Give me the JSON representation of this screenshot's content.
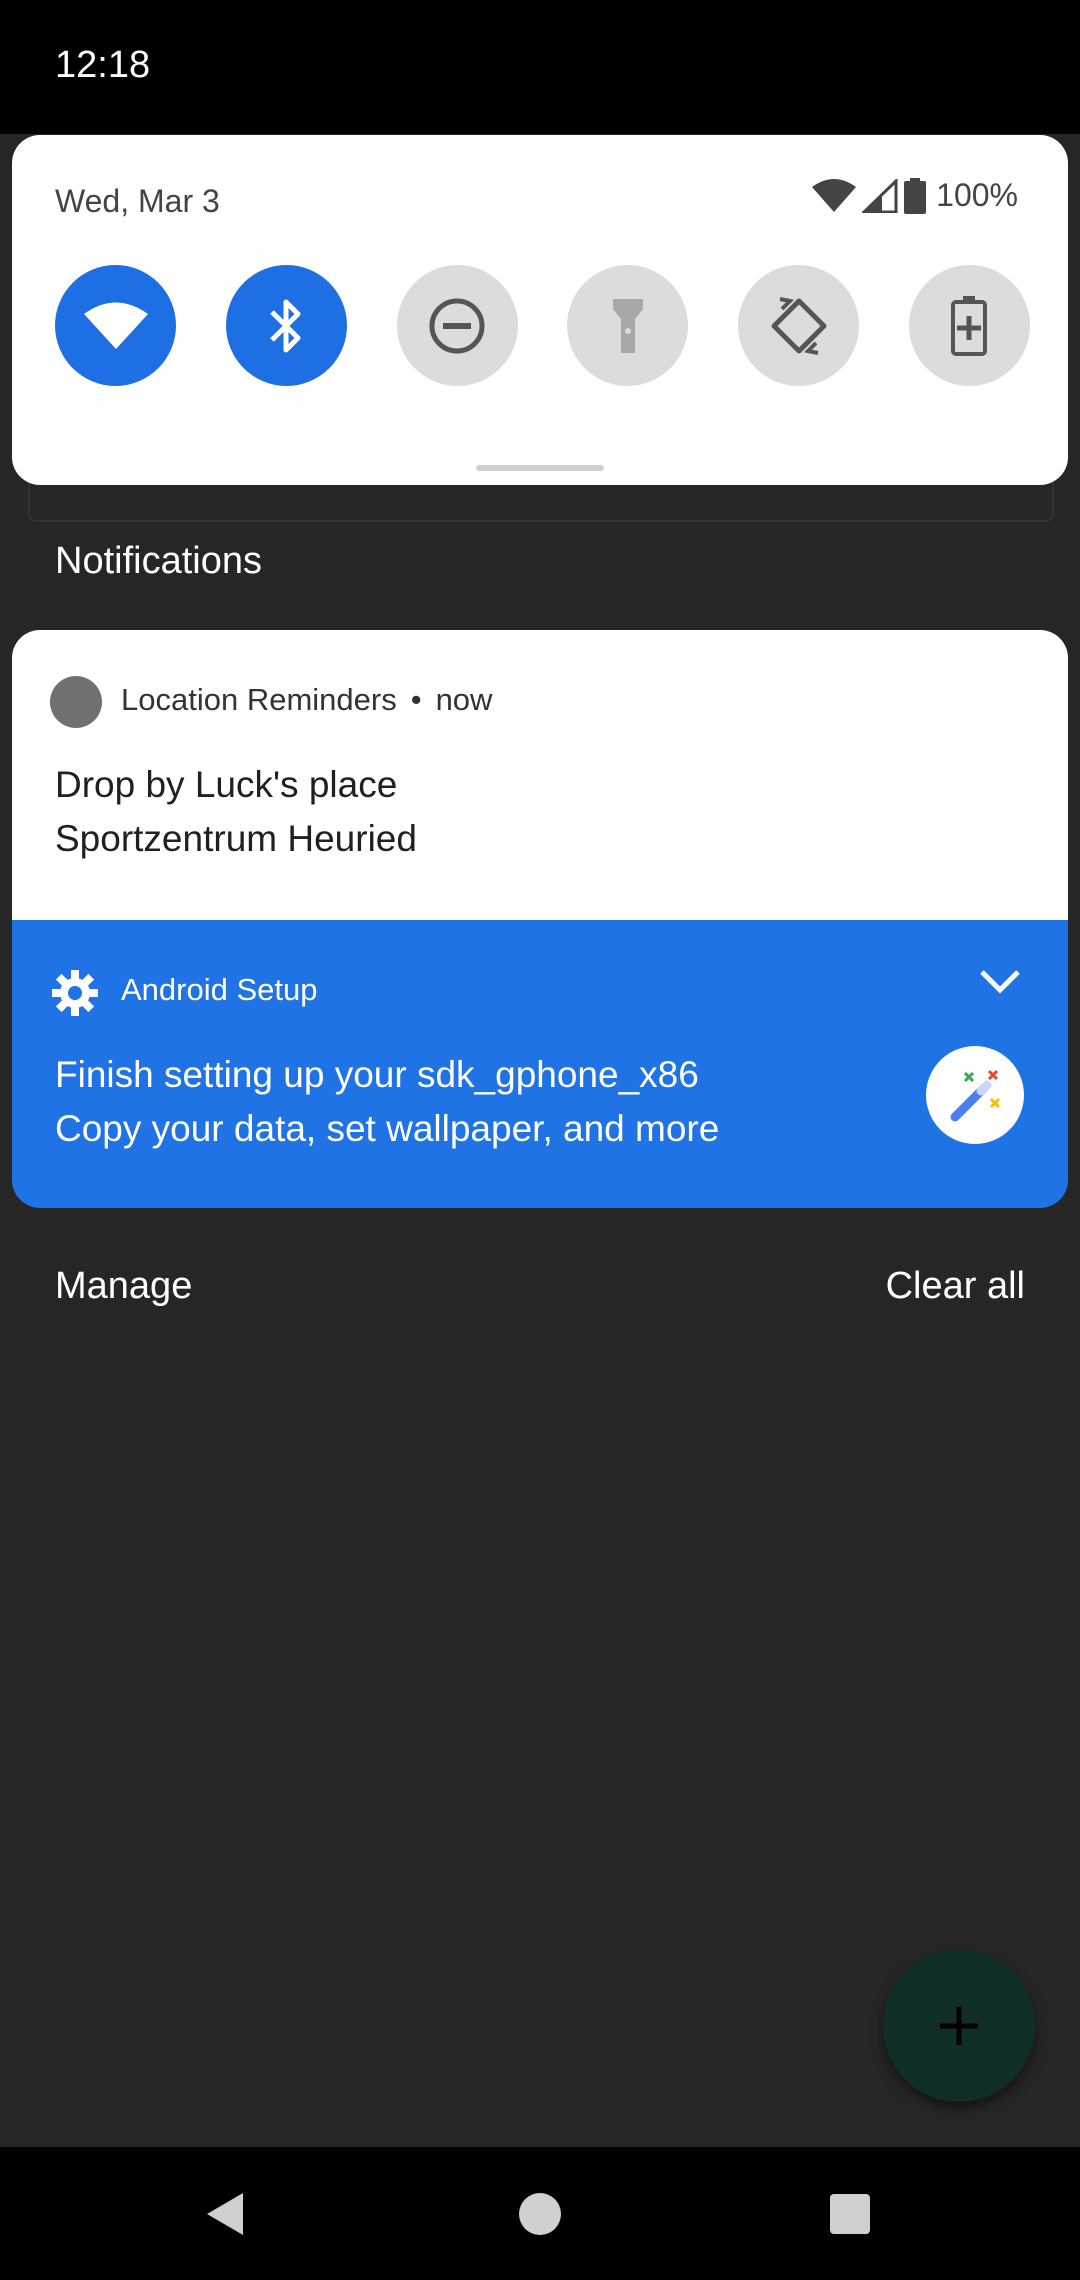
{
  "status_bar": {
    "time": "12:18"
  },
  "quick_settings": {
    "date": "Wed, Mar 3",
    "battery": "100%",
    "tiles": [
      {
        "name": "wifi",
        "state": "on"
      },
      {
        "name": "bluetooth",
        "state": "on"
      },
      {
        "name": "do-not-disturb",
        "state": "off"
      },
      {
        "name": "flashlight",
        "state": "off"
      },
      {
        "name": "auto-rotate",
        "state": "off"
      },
      {
        "name": "battery-saver",
        "state": "off"
      }
    ]
  },
  "notifications_header": "Notifications",
  "notifications": [
    {
      "app": "Location Reminders",
      "separator": "•",
      "time": "now",
      "title": "Drop by Luck's place",
      "text": "Sportzentrum Heuried"
    },
    {
      "app": "Android Setup",
      "title": "Finish setting up your sdk_gphone_x86",
      "text": "Copy your data, set wallpaper, and more"
    }
  ],
  "actions": {
    "manage": "Manage",
    "clear_all": "Clear all"
  },
  "colors": {
    "accent": "#1d6fe3",
    "setup_card": "#1f73e4",
    "background": "#262626"
  }
}
